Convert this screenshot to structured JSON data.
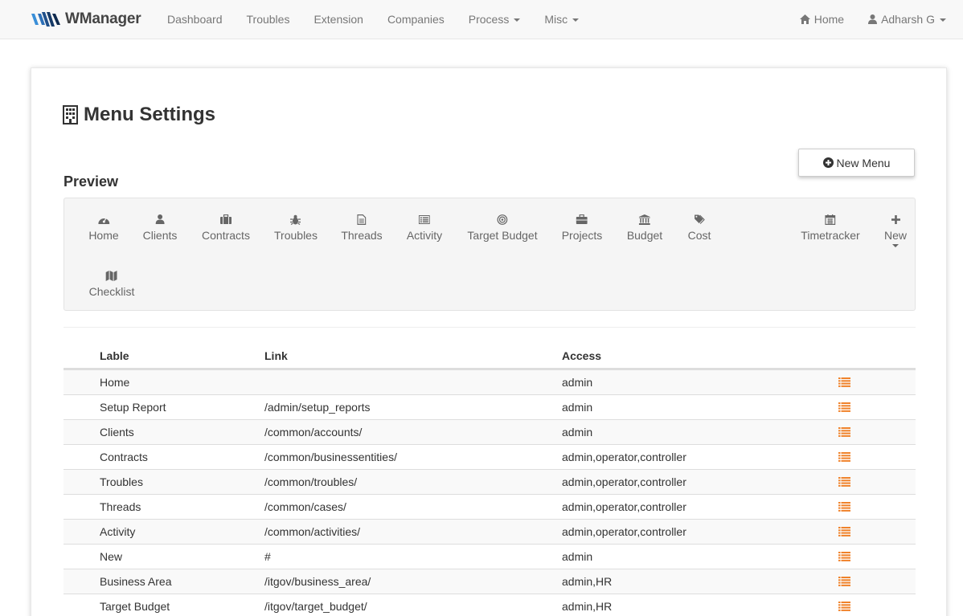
{
  "brand": {
    "name": "WManager",
    "logo_color": "#2c6fb7"
  },
  "nav": {
    "left": [
      {
        "label": "Dashboard",
        "dropdown": false
      },
      {
        "label": "Troubles",
        "dropdown": false
      },
      {
        "label": "Extension",
        "dropdown": false
      },
      {
        "label": "Companies",
        "dropdown": false
      },
      {
        "label": "Process",
        "dropdown": true
      },
      {
        "label": "Misc",
        "dropdown": true
      }
    ],
    "home_label": "Home",
    "user_label": "Adharsh G"
  },
  "page": {
    "title": "Menu Settings",
    "new_menu_label": "New Menu",
    "preview_heading": "Preview"
  },
  "preview": [
    {
      "label": "Home",
      "icon": "dashboard-icon"
    },
    {
      "label": "Clients",
      "icon": "user-icon"
    },
    {
      "label": "Contracts",
      "icon": "briefcase-icon"
    },
    {
      "label": "Troubles",
      "icon": "bug-icon"
    },
    {
      "label": "Threads",
      "icon": "file-text-icon"
    },
    {
      "label": "Activity",
      "icon": "list-alt-icon"
    },
    {
      "label": "Target Budget",
      "icon": "bullseye-icon"
    },
    {
      "label": "Projects",
      "icon": "toolbox-icon"
    },
    {
      "label": "Budget",
      "icon": "bank-icon"
    },
    {
      "label": "Cost",
      "icon": "tags-icon"
    },
    {
      "label": "Timetracker",
      "icon": "calendar-icon"
    },
    {
      "label": "New",
      "icon": "plus-icon",
      "dropdown": true
    },
    {
      "label": "Checklist",
      "icon": "map-icon"
    }
  ],
  "table": {
    "headers": [
      "Lable",
      "Link",
      "Access",
      ""
    ],
    "rows": [
      {
        "label": "Home",
        "link": "",
        "access": "admin"
      },
      {
        "label": "Setup Report",
        "link": "/admin/setup_reports",
        "access": "admin"
      },
      {
        "label": "Clients",
        "link": "/common/accounts/",
        "access": "admin"
      },
      {
        "label": "Contracts",
        "link": "/common/businessentities/",
        "access": "admin,operator,controller"
      },
      {
        "label": "Troubles",
        "link": "/common/troubles/",
        "access": "admin,operator,controller"
      },
      {
        "label": "Threads",
        "link": "/common/cases/",
        "access": "admin,operator,controller"
      },
      {
        "label": "Activity",
        "link": "/common/activities/",
        "access": "admin,operator,controller"
      },
      {
        "label": "New",
        "link": "#",
        "access": "admin"
      },
      {
        "label": "Business Area",
        "link": "/itgov/business_area/",
        "access": "admin,HR"
      },
      {
        "label": "Target Budget",
        "link": "/itgov/target_budget/",
        "access": "admin,HR"
      }
    ],
    "action_icon": "list-icon",
    "action_color": "#f0822a"
  }
}
